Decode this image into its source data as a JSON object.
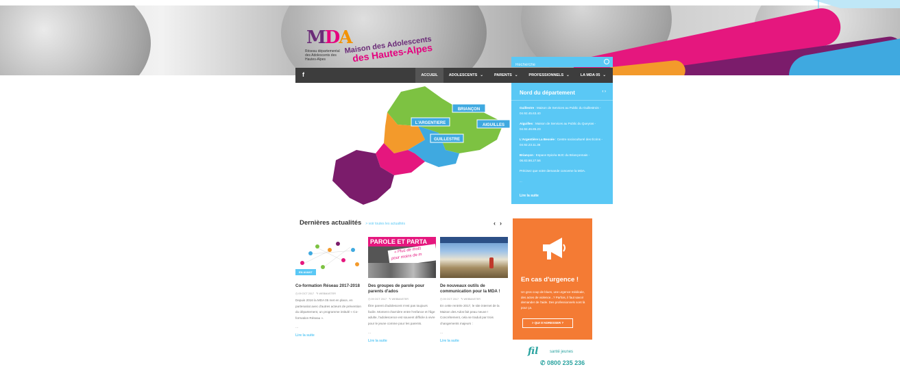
{
  "site": {
    "logo_letters": [
      "M",
      "D",
      "A"
    ],
    "logo_sub": "Réseau départemental des Adolescents des Hautes-Alpes",
    "logo_name_line1": "Maison des Adolescents",
    "logo_name_line2": "des Hautes-Alpes"
  },
  "search": {
    "placeholder": "Recherche",
    "icon": "search-icon"
  },
  "nav": {
    "facebook": "f",
    "items": [
      {
        "label": "ACCUEIL",
        "active": true,
        "dropdown": false
      },
      {
        "label": "ADOLESCENTS",
        "active": false,
        "dropdown": true
      },
      {
        "label": "PARENTS",
        "active": false,
        "dropdown": true
      },
      {
        "label": "PROFESSIONNELS",
        "active": false,
        "dropdown": true
      },
      {
        "label": "LA MDA 05",
        "active": false,
        "dropdown": true
      }
    ]
  },
  "map": {
    "labels": [
      "BRIANÇON",
      "L'ARGENTIERE",
      "AIGUILLES",
      "GUILLESTRE"
    ],
    "colors": {
      "north": "#7dc242",
      "orange": "#f39a2b",
      "blue": "#3fa9e0",
      "pink": "#e5177e",
      "purple": "#7b1c6b"
    }
  },
  "infobox": {
    "title": "Nord du département",
    "arrows": "‹ ›",
    "entries": [
      {
        "place": "Guillestre",
        "text": " : Maison de Services au Public du Guillestrois - 04.92.45.63.40"
      },
      {
        "place": "Aiguilles",
        "text": " : Maison de Services au Public du Queyras - 04.92.46.85.23"
      },
      {
        "place": "L'Argentière La Bessée",
        "text": " : Centre socioculturel des Écrins - 04.92.23.11.36"
      },
      {
        "place": "Briançon",
        "text": " : Espace Epicéa MJC du Briançonnais - 06.83.98.27.56"
      }
    ],
    "note": "Précisez que votre demande concerne la MDA.",
    "dots": "...",
    "more": "Lire la suite"
  },
  "news": {
    "title": "Dernières actualités",
    "all_link": "> voir toutes les actualités",
    "prev": "‹",
    "next": "›",
    "cards": [
      {
        "badge": "EN AVANT",
        "title": "Co-formation Réseau 2017-2018",
        "date": "09 OCT 2017",
        "author": "WEBMASTER",
        "text": "Depuis 2016 la MDA 05 met en place, en partenariat avec d'autres acteurs de prévention du département, un programme intitulé « Co-formation Réseau ».",
        "dots": "...",
        "more": "Lire la suite"
      },
      {
        "image_text_1": "PAROLE ET PARTA",
        "image_text_2": "« Plus de mots",
        "image_text_3": "pour moins de m",
        "title": "Des groupes de parole pour parents d'ados",
        "date": "09 OCT 2017",
        "author": "WEBMASTER",
        "text": "Être parent d'adolescent n'est pas toujours facile. Moment charnière entre l'enfance et l'âge adulte, l'adolescence est souvent difficile à vivre pour le jeune comme pour les parents.",
        "dots": "...",
        "more": "Lire la suite"
      },
      {
        "title": "De nouveaux outils de communication pour la MDA !",
        "date": "09 OCT 2017",
        "author": "WEBMASTER",
        "text": "En cette rentrée 2017, le site internet de la Maison des Ados fait peau neuve ! Concrètement, cela se traduit par trois changements majeurs :",
        "dots": "...",
        "more": "Lire la suite"
      }
    ]
  },
  "urgence": {
    "title": "En cas d'urgence !",
    "text": "Un gros coup de blues, une urgence médicale, des actes de violence...? Parfois, il faut savoir demander de l'aide. Des professionnels sont là pour ça.",
    "button": "> QUI S'ADRESSER ?"
  },
  "fil": {
    "brand": "fil",
    "brand_sub": "santé jeunes",
    "phone": "0800 235 236"
  }
}
